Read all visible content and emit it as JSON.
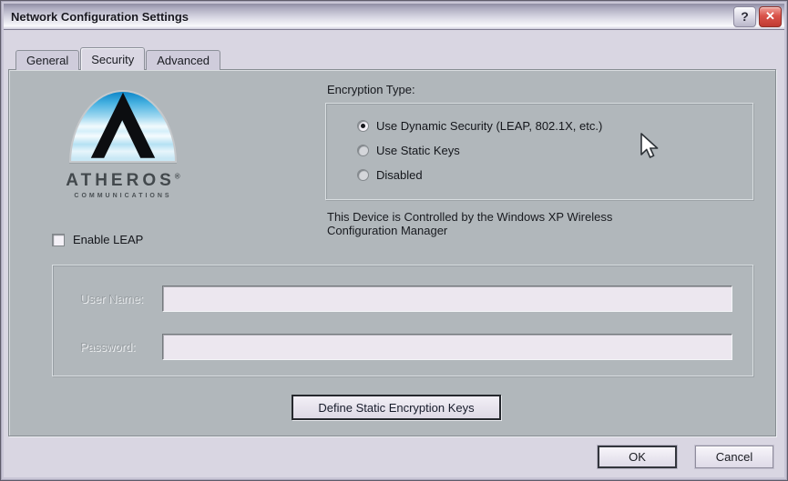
{
  "window": {
    "title": "Network Configuration Settings",
    "help_button_glyph": "?",
    "close_button_glyph": "✕"
  },
  "tabs": [
    {
      "label": "General",
      "active": false
    },
    {
      "label": "Security",
      "active": true
    },
    {
      "label": "Advanced",
      "active": false
    }
  ],
  "logo": {
    "brand": "ATHEROS",
    "registered_mark": "®",
    "subtitle": "COMMUNICATIONS"
  },
  "security": {
    "encryption_type_label": "Encryption Type:",
    "radio_options": [
      {
        "label": "Use Dynamic Security (LEAP, 802.1X, etc.)",
        "selected": true
      },
      {
        "label": "Use Static Keys",
        "selected": false
      },
      {
        "label": "Disabled",
        "selected": false
      }
    ],
    "device_note_line1": "This Device is Controlled by the Windows XP Wireless",
    "device_note_line2": "Configuration Manager",
    "enable_leap_label": "Enable LEAP",
    "enable_leap_checked": false,
    "user_name_label": "User Name:",
    "user_name_value": "",
    "password_label": "Password:",
    "password_value": "",
    "define_keys_button_label": "Define Static Encryption Keys"
  },
  "footer": {
    "ok_label": "OK",
    "cancel_label": "Cancel"
  },
  "colors": {
    "dialog_background": "#d9d6e2",
    "panel_background": "#b1b7bb",
    "titlebar_top": "#8f8da3",
    "close_button_red": "#d9534a",
    "field_background": "#ece7ef",
    "logo_blue": "#0e86c8"
  }
}
